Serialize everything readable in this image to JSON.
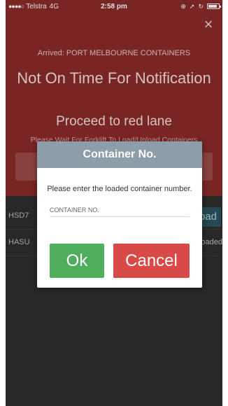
{
  "status_bar": {
    "signal": "●●●●○",
    "carrier": "Telstra",
    "network": "4G",
    "time": "2:58 pm",
    "icons": [
      "alarm-icon",
      "location-icon",
      "lock-rotation-icon",
      "battery-icon"
    ]
  },
  "banner": {
    "close_label": "×",
    "arrived_text": "Arrived: PORT MELBOURNE CONTAINERS",
    "headline": "Not On Time For Notification",
    "proceed_text": "Proceed to red lane",
    "wait_text": "Please Wait For Forklift To Load/Unload Containers",
    "color": "#8a2b29"
  },
  "list": {
    "rows": [
      {
        "code": "HSD7",
        "action": "oad"
      },
      {
        "code": "HASU",
        "status": "oaded"
      }
    ]
  },
  "modal": {
    "title": "Container No.",
    "message": "Please enter the loaded container number.",
    "input_placeholder": "CONTAINER NO.",
    "input_value": "",
    "ok_label": "Ok",
    "cancel_label": "Cancel",
    "header_color": "#8e9ea8",
    "ok_color": "#4fae5e",
    "cancel_color": "#d74a47"
  }
}
